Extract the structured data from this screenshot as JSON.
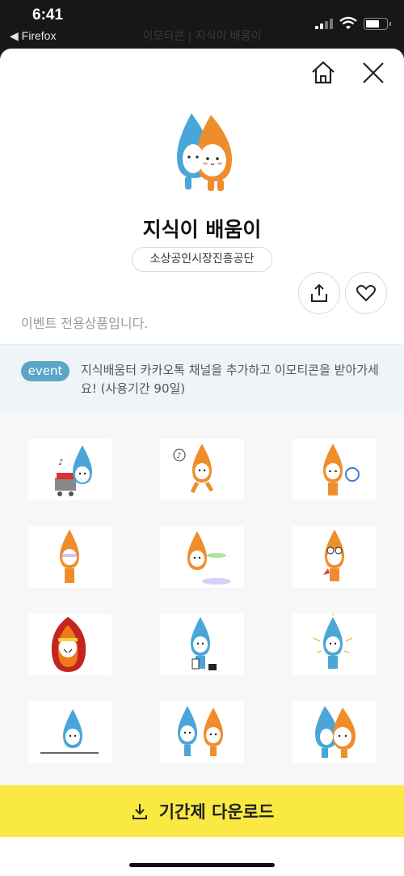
{
  "status_bar": {
    "time": "6:41",
    "back_app": "◀ Firefox",
    "page_title": "이모티콘 | 지식이 배움이"
  },
  "header": {
    "home_icon": "home-icon",
    "close_icon": "close-icon"
  },
  "product": {
    "title": "지식이 배움이",
    "author": "소상공인시장진흥공단",
    "notice": "이벤트 전용상품입니다."
  },
  "actions": {
    "share_icon": "share-icon",
    "like_icon": "heart-icon"
  },
  "event": {
    "badge": "event",
    "text": "지식배움터 카카오톡 채널을 추가하고 이모티콘을 받아가세요! (사용기간 90일)"
  },
  "stickers": [
    {
      "character": "blue",
      "prop": "cart"
    },
    {
      "character": "orange",
      "prop": "running"
    },
    {
      "character": "orange",
      "prop": "magnifier"
    },
    {
      "character": "orange",
      "prop": "glitch"
    },
    {
      "character": "orange",
      "prop": "spin"
    },
    {
      "character": "orange",
      "prop": "goggles"
    },
    {
      "character": "blue",
      "prop": "fire"
    },
    {
      "character": "blue",
      "prop": "wallet"
    },
    {
      "character": "blue",
      "prop": "sparkle"
    },
    {
      "character": "blue",
      "prop": "line"
    },
    {
      "character": "pair",
      "prop": "hug"
    },
    {
      "character": "pair",
      "prop": "hug2"
    }
  ],
  "download": {
    "label": "기간제 다운로드",
    "icon": "download-icon"
  },
  "colors": {
    "accent_yellow": "#fbe943",
    "event_badge": "#5aa6c7",
    "blue_char": "#4aa6d8",
    "orange_char": "#ef8d2c"
  }
}
